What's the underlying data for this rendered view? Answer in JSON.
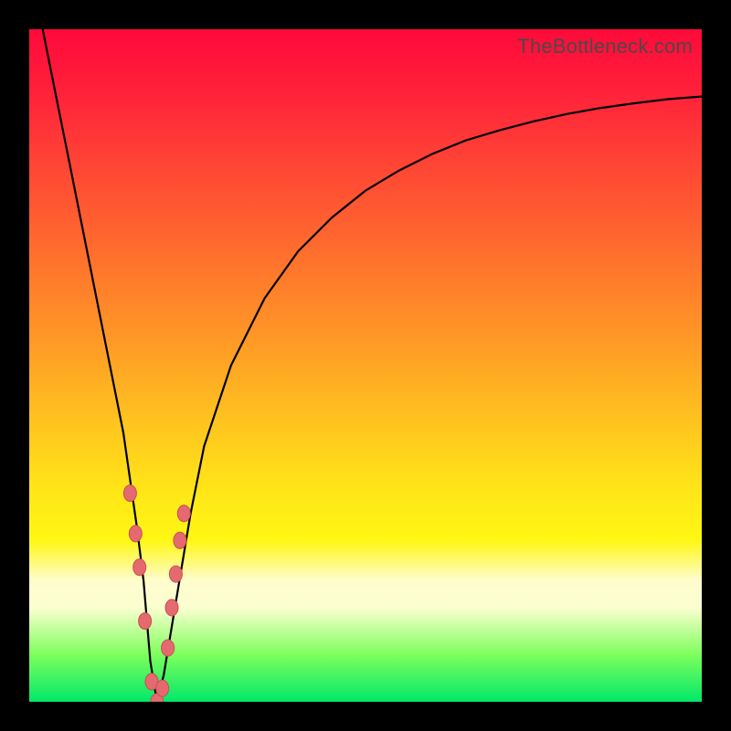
{
  "watermark": "TheBottleneck.com",
  "chart_data": {
    "type": "line",
    "title": "",
    "xlabel": "",
    "ylabel": "",
    "xlim": [
      0,
      100
    ],
    "ylim": [
      0,
      100
    ],
    "series": [
      {
        "name": "bottleneck-curve",
        "x": [
          2,
          4,
          6,
          8,
          10,
          12,
          14,
          16,
          17,
          18,
          19,
          20,
          22,
          24,
          26,
          30,
          35,
          40,
          45,
          50,
          55,
          60,
          65,
          70,
          75,
          80,
          85,
          90,
          95,
          100
        ],
        "values": [
          100,
          90,
          80,
          70,
          60,
          50,
          40,
          26,
          18,
          6,
          0,
          4,
          16,
          28,
          38,
          50,
          60,
          67,
          72,
          76,
          79,
          81.5,
          83.5,
          85,
          86.3,
          87.4,
          88.3,
          89,
          89.6,
          90
        ]
      }
    ],
    "markers": {
      "name": "highlight-beads",
      "x": [
        15.0,
        15.8,
        16.4,
        17.2,
        18.2,
        19.0,
        19.8,
        20.6,
        21.2,
        21.8,
        22.4,
        23.0
      ],
      "values": [
        31,
        25,
        20,
        12,
        3,
        0,
        2,
        8,
        14,
        19,
        24,
        28
      ]
    },
    "background_gradient": {
      "top": "#ff0a3a",
      "mid_upper": "#ff9826",
      "mid": "#fff714",
      "pale_band": "#fbffd0",
      "bottom": "#00e86a"
    }
  }
}
